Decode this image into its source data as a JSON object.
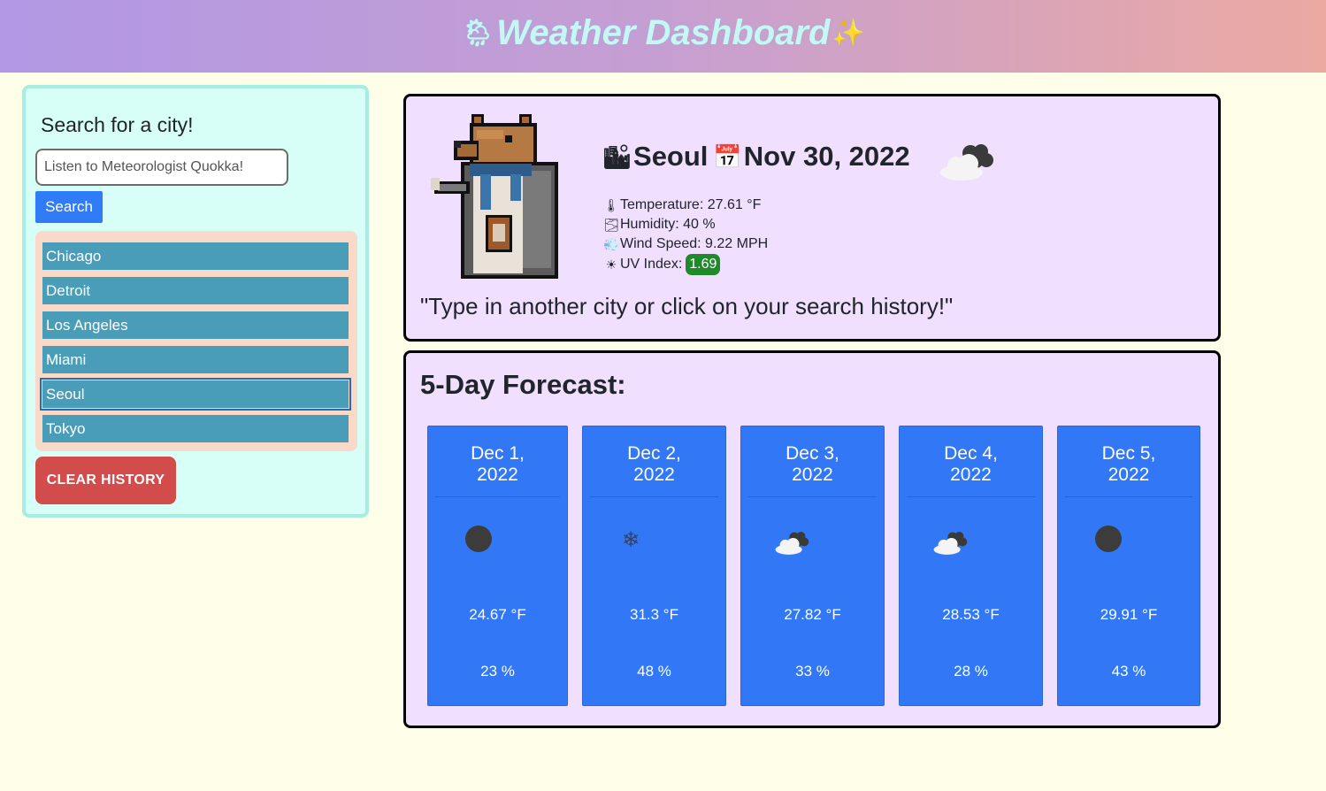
{
  "header": {
    "title": "Weather Dashboard",
    "left_icon": "cloud-rain-icon",
    "right_icon": "sparkles-icon"
  },
  "sidebar": {
    "title": "Search for a city!",
    "search_placeholder": "Listen to Meteorologist Quokka!",
    "search_value": "",
    "search_label": "Search",
    "history": [
      "Chicago",
      "Detroit",
      "Los Angeles",
      "Miami",
      "Seoul",
      "Tokyo"
    ],
    "active_city": "Seoul",
    "clear_label": "CLEAR HISTORY"
  },
  "current": {
    "city": "Seoul",
    "date": "Nov 30, 2022",
    "weather_icon": "cloudy-icon",
    "temperature": "Temperature: 27.61 °F",
    "humidity": "Humidity: 40 %",
    "wind": "Wind Speed: 9.22 MPH",
    "uv_label": "UV Index:",
    "uv_value": "1.69",
    "quote": "\"Type in another city or click on your search history!\""
  },
  "forecast": {
    "title": "5-Day Forecast:",
    "days": [
      {
        "date": "Dec 1,\n2022",
        "icon": "clear-night-icon",
        "temp": "24.67 °F",
        "humidity": "23 %"
      },
      {
        "date": "Dec 2,\n2022",
        "icon": "snow-icon",
        "temp": "31.3 °F",
        "humidity": "48 %"
      },
      {
        "date": "Dec 3,\n2022",
        "icon": "cloudy-icon",
        "temp": "27.82 °F",
        "humidity": "33 %"
      },
      {
        "date": "Dec 4,\n2022",
        "icon": "cloudy-icon",
        "temp": "28.53 °F",
        "humidity": "28 %"
      },
      {
        "date": "Dec 5,\n2022",
        "icon": "clear-night-icon",
        "temp": "29.91 °F",
        "humidity": "43 %"
      }
    ]
  },
  "colors": {
    "header_start": "#b197e4",
    "header_end": "#eba9a2",
    "sidebar_bg": "#d7fff7",
    "history_bg": "#f9d9c8",
    "history_item": "#4a9db8",
    "search_button": "#2f7cf6",
    "clear_button": "#d24c4c",
    "card_bg": "#f0dfff",
    "forecast_day": "#3278f6",
    "uv_badge": "#1f8a2a"
  }
}
